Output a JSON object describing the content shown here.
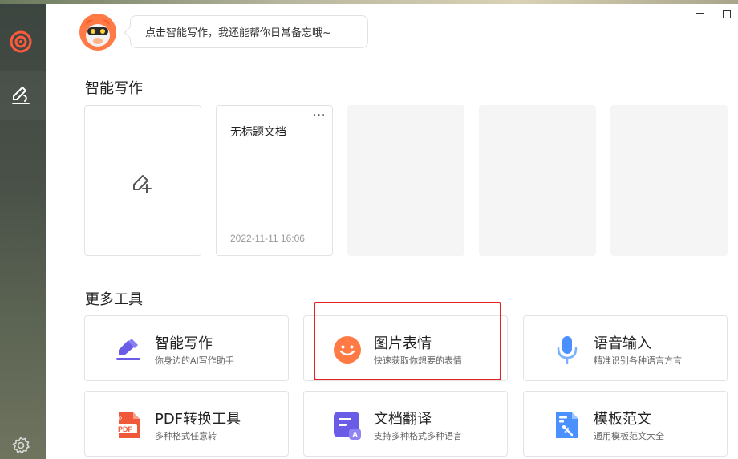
{
  "assistant": {
    "tip": "点击智能写作，我还能帮你日常备忘哦~"
  },
  "sections": {
    "writing_title": "智能写作",
    "tools_title": "更多工具"
  },
  "documents": [
    {
      "title": "无标题文档",
      "date": "2022-11-11 16:06",
      "more": "···"
    }
  ],
  "tools": [
    {
      "name": "智能写作",
      "desc": "你身边的AI写作助手",
      "icon": "pencil-icon"
    },
    {
      "name": "图片表情",
      "desc": "快速获取你想要的表情",
      "icon": "smiley-icon"
    },
    {
      "name": "语音输入",
      "desc": "精准识别各种语言方言",
      "icon": "microphone-icon"
    },
    {
      "name": "PDF转换工具",
      "desc": "多种格式任意转",
      "icon": "pdf-icon"
    },
    {
      "name": "文档翻译",
      "desc": "支持多种格式多种语言",
      "icon": "translate-icon"
    },
    {
      "name": "模板范文",
      "desc": "通用模板范文大全",
      "icon": "template-icon"
    }
  ],
  "colors": {
    "brand_orange": "#ff7a45",
    "purple": "#6b5ce7",
    "blue": "#4a90ff",
    "red_pdf": "#f0583a",
    "highlight": "#e52222"
  }
}
